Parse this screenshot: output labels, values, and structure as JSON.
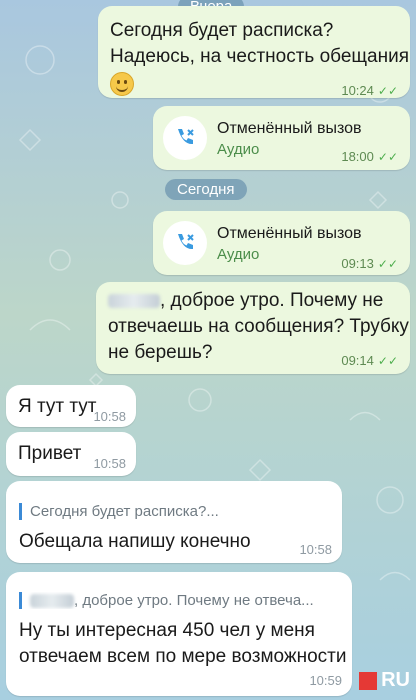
{
  "date_separators": {
    "yesterday": "Вчера",
    "today": "Сегодня"
  },
  "messages": [
    {
      "id": "m1",
      "direction": "outgoing",
      "text_line1": "Сегодня будет расписка?",
      "text_line2": "Надеюсь, на честность обещания",
      "emoji": "smiling-face",
      "time": "10:24",
      "status": "read"
    },
    {
      "id": "m2",
      "direction": "outgoing",
      "type": "call",
      "call_title": "Отменённый вызов",
      "call_subtitle": "Аудио",
      "time": "18:00",
      "status": "read"
    },
    {
      "id": "m3",
      "direction": "outgoing",
      "type": "call",
      "call_title": "Отменённый вызов",
      "call_subtitle": "Аудио",
      "time": "09:13",
      "status": "read"
    },
    {
      "id": "m4",
      "direction": "outgoing",
      "text_line1": ", доброе утро. Почему не",
      "text_line2": "отвечаешь на сообщения? Трубку",
      "text_line3": "не берешь?",
      "time": "09:14",
      "status": "read"
    },
    {
      "id": "m5",
      "direction": "incoming",
      "text": "Я тут тут",
      "time": "10:58"
    },
    {
      "id": "m6",
      "direction": "incoming",
      "text": "Привет",
      "time": "10:58"
    },
    {
      "id": "m7",
      "direction": "incoming",
      "reply_preview": "Сегодня будет расписка?...",
      "text": "Обещала напишу конечно",
      "time": "10:58"
    },
    {
      "id": "m8",
      "direction": "incoming",
      "reply_preview": ", доброе утро. Почему не отвеча...",
      "text_line1": "Ну ты интересная 450 чел у меня",
      "text_line2": "отвечаем всем по мере возможности",
      "time": "10:59"
    }
  ],
  "icons": {
    "read_ticks": "double-check-icon",
    "call": "cancelled-call-icon"
  },
  "colors": {
    "outgoing_bubble": "#ecf8df",
    "incoming_bubble": "#ffffff",
    "date_pill": "#6e96af",
    "call_subtitle": "#4b8d4a",
    "reply_bar": "#3b8ad6"
  },
  "watermark": "RU"
}
